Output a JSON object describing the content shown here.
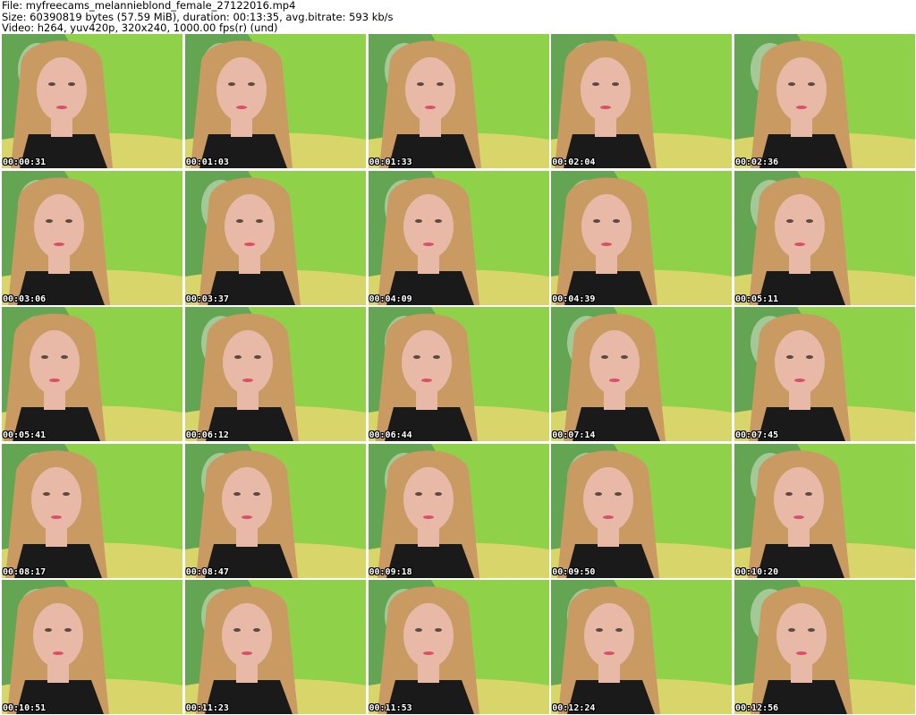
{
  "header": {
    "line1": "File: myfreecams_melannieblond_female_27122016.mp4",
    "line2": "Size: 60390819 bytes (57.59 MiB), duration: 00:13:35, avg.bitrate: 593 kb/s",
    "line3": "Video: h264, yuv420p, 320x240, 1000.00 fps(r) (und)"
  },
  "colors": {
    "background_green": "#8fd24a",
    "couch_yellow": "#d8d66a",
    "hair": "#c99a62",
    "skin": "#e7b9a6",
    "top_black": "#1a1a1a",
    "plant_dark": "#3f7f5a"
  },
  "thumbnails": [
    {
      "timestamp": "00:00:31"
    },
    {
      "timestamp": "00:01:03"
    },
    {
      "timestamp": "00:01:33"
    },
    {
      "timestamp": "00:02:04"
    },
    {
      "timestamp": "00:02:36"
    },
    {
      "timestamp": "00:03:06"
    },
    {
      "timestamp": "00:03:37"
    },
    {
      "timestamp": "00:04:09"
    },
    {
      "timestamp": "00:04:39"
    },
    {
      "timestamp": "00:05:11"
    },
    {
      "timestamp": "00:05:41"
    },
    {
      "timestamp": "00:06:12"
    },
    {
      "timestamp": "00:06:44"
    },
    {
      "timestamp": "00:07:14"
    },
    {
      "timestamp": "00:07:45"
    },
    {
      "timestamp": "00:08:17"
    },
    {
      "timestamp": "00:08:47"
    },
    {
      "timestamp": "00:09:18"
    },
    {
      "timestamp": "00:09:50"
    },
    {
      "timestamp": "00:10:20"
    },
    {
      "timestamp": "00:10:51"
    },
    {
      "timestamp": "00:11:23"
    },
    {
      "timestamp": "00:11:53"
    },
    {
      "timestamp": "00:12:24"
    },
    {
      "timestamp": "00:12:56"
    }
  ]
}
